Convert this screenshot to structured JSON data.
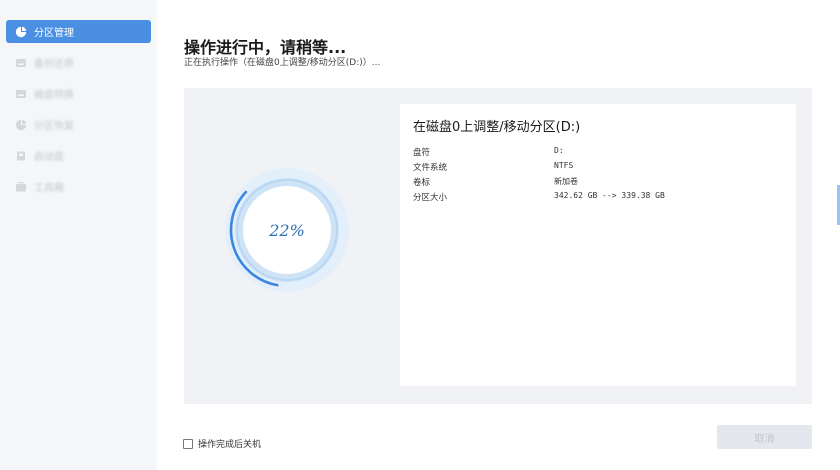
{
  "sidebar": {
    "items": [
      {
        "label": "分区管理",
        "icon": "pie-chart-icon",
        "active": true
      },
      {
        "label": "备份还原",
        "icon": "disk-icon",
        "active": false
      },
      {
        "label": "磁盘转换",
        "icon": "disk-icon",
        "active": false
      },
      {
        "label": "分区恢复",
        "icon": "pie-chart-icon",
        "active": false
      },
      {
        "label": "启动盘",
        "icon": "usb-drive-icon",
        "active": false
      },
      {
        "label": "工具箱",
        "icon": "toolbox-icon",
        "active": false
      }
    ],
    "accent_color": "#4a8fe2"
  },
  "header": {
    "title": "操作进行中，请稍等...",
    "subtitle": "正在执行操作（在磁盘0上调整/移动分区(D:)）..."
  },
  "progress": {
    "percent_label": "22%",
    "value": 0.22
  },
  "operation": {
    "title": "在磁盘0上调整/移动分区(D:)",
    "rows": [
      {
        "key": "盘符",
        "value": "D:"
      },
      {
        "key": "文件系统",
        "value": "NTFS"
      },
      {
        "key": "卷标",
        "value": "新加卷"
      },
      {
        "key": "分区大小",
        "value": "342.62 GB --> 339.38 GB"
      }
    ]
  },
  "footer": {
    "shutdown_label": "操作完成后关机",
    "shutdown_checked": false,
    "cancel_label": "取消"
  }
}
